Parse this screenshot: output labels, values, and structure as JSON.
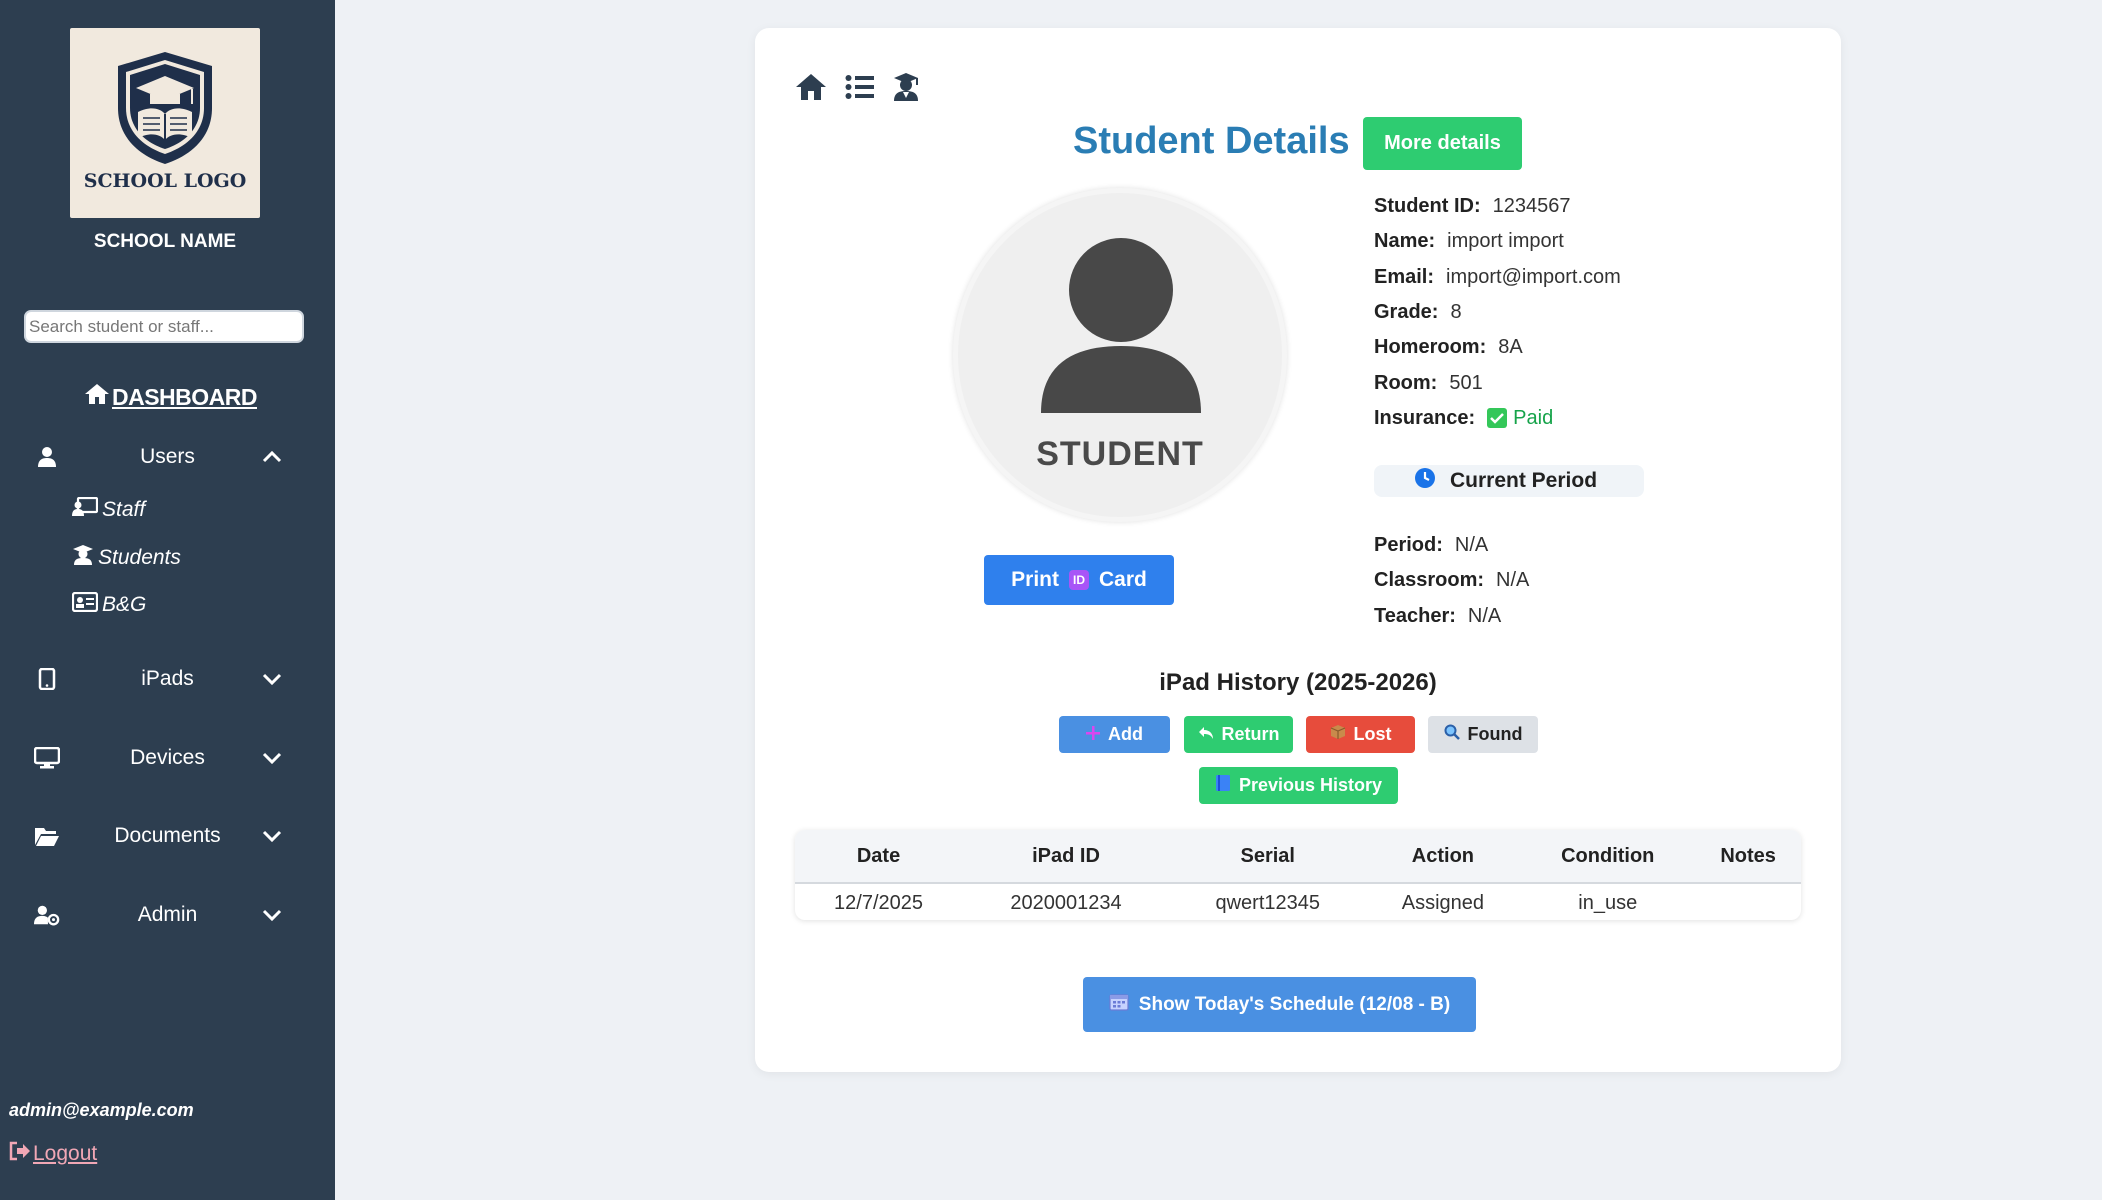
{
  "sidebar": {
    "logo_text": "SCHOOL LOGO",
    "school_name": "SCHOOL NAME",
    "search_placeholder": "Search student or staff...",
    "dashboard_label": "DASHBOARD",
    "groups": [
      {
        "label": "Users",
        "icon": "user-icon",
        "expanded": true
      },
      {
        "label": "iPads",
        "icon": "tablet-icon",
        "expanded": false
      },
      {
        "label": "Devices",
        "icon": "desktop-icon",
        "expanded": false
      },
      {
        "label": "Documents",
        "icon": "folder-icon",
        "expanded": false
      },
      {
        "label": "Admin",
        "icon": "user-gear-icon",
        "expanded": false
      }
    ],
    "user_sub_items": [
      {
        "label": "Staff",
        "icon": "chalkboard-teacher-icon"
      },
      {
        "label": "Students",
        "icon": "graduate-icon"
      },
      {
        "label": "B&G",
        "icon": "id-card-icon"
      }
    ],
    "admin_email": "admin@example.com",
    "logout_label": "Logout"
  },
  "main": {
    "title": "Student Details",
    "more_details_label": "More details",
    "avatar_label": "STUDENT",
    "print_card": {
      "before": "Print",
      "badge": "ID",
      "after": "Card"
    },
    "details": [
      {
        "key": "Student ID:",
        "value": "1234567"
      },
      {
        "key": "Name:",
        "value": "import import"
      },
      {
        "key": "Email:",
        "value": "import@import.com"
      },
      {
        "key": "Grade:",
        "value": "8"
      },
      {
        "key": "Homeroom:",
        "value": "8A"
      },
      {
        "key": "Room:",
        "value": "501"
      }
    ],
    "insurance": {
      "key": "Insurance:",
      "value": "Paid"
    },
    "current_period_label": "Current Period",
    "period_details": [
      {
        "key": "Period:",
        "value": "N/A"
      },
      {
        "key": "Classroom:",
        "value": "N/A"
      },
      {
        "key": "Teacher:",
        "value": "N/A"
      }
    ],
    "history_title": "iPad History (2025-2026)",
    "buttons": {
      "add": "Add",
      "return": "Return",
      "lost": "Lost",
      "found": "Found",
      "previous_history": "Previous History"
    },
    "table": {
      "headers": [
        "Date",
        "iPad ID",
        "Serial",
        "Action",
        "Condition",
        "Notes"
      ],
      "rows": [
        [
          "12/7/2025",
          "2020001234",
          "qwert12345",
          "Assigned",
          "in_use",
          ""
        ]
      ]
    },
    "schedule_button_label": "Show Today's Schedule (12/08 - B)"
  },
  "colors": {
    "sidebar_bg": "#2d3e50",
    "title_blue": "#2a7db4",
    "green": "#2ecc71",
    "blue": "#2f80ed",
    "red": "#e74c3c",
    "logout_pink": "#f1a7b5"
  }
}
